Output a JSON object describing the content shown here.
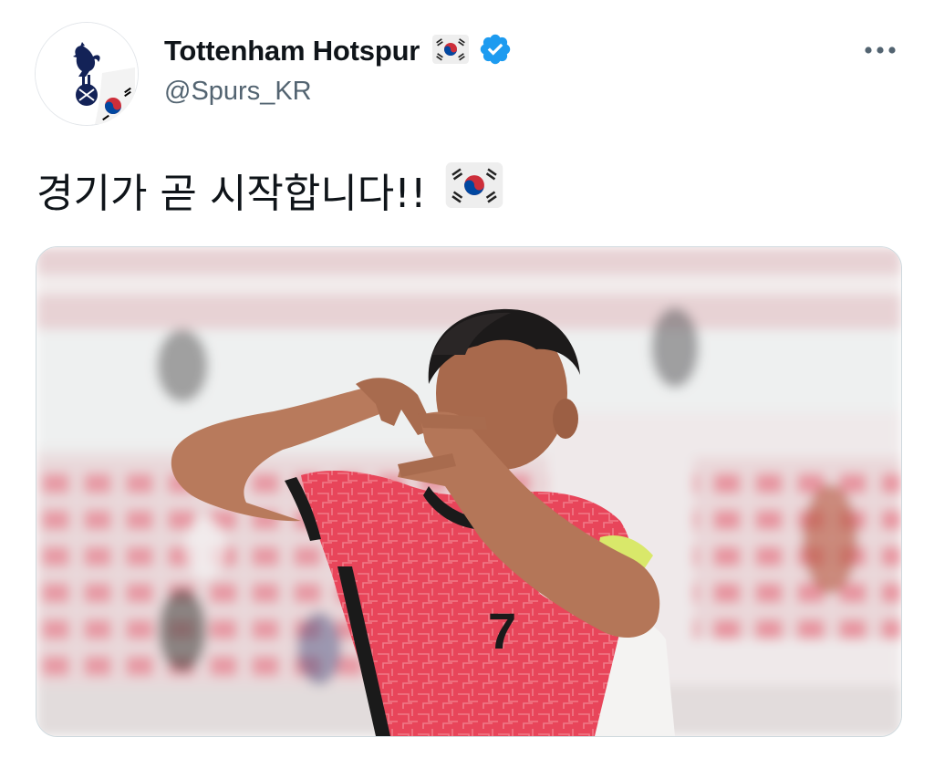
{
  "author": {
    "display_name": "Tottenham Hotspur",
    "handle": "@Spurs_KR",
    "avatar_icon": "spurs-cockerel-logo",
    "name_emoji": "south-korea-flag-icon",
    "verified_icon": "verified-badge-icon"
  },
  "menu": {
    "icon": "more-dots-icon"
  },
  "tweet": {
    "text": "경기가 곧 시작합니다!!",
    "text_emoji": "south-korea-flag-icon"
  },
  "media": {
    "type": "photo",
    "number_on_shirt": "7"
  },
  "colors": {
    "name": "#0f1419",
    "handle": "#536471",
    "verified": "#1d9bf0",
    "jersey": "#e8455a",
    "media_border": "#cfd9de"
  }
}
